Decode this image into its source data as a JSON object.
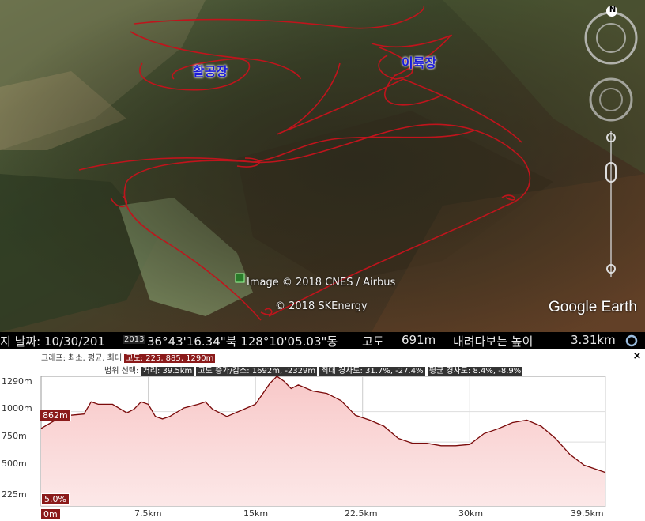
{
  "map": {
    "north_label": "N",
    "places": [
      "활공장",
      "이륙장"
    ],
    "attribution_1": "Image © 2018 CNES / Airbus",
    "attribution_2": "© 2018 SKEnergy",
    "logo": "Google Earth",
    "track_color": "#c0141c"
  },
  "status": {
    "date_label": "지 날짜: 10/30/201",
    "year_badge": "2013",
    "coords": "36°43'16.34\"북 128°10'05.03\"동",
    "alt_label": "고도",
    "alt_value": "691m",
    "eye_label": "내려다보는 높이",
    "eye_value": "3.31km"
  },
  "profile": {
    "graph_label": "그래프: 최소, 평균, 최대",
    "elev_label": "고도:",
    "elev_values": "225, 885, 1290m",
    "range_label": "범위 선택:",
    "distance": "거리: 39.5km",
    "gain_loss": "고도 증가/감소: 1692m, -2329m",
    "max_slope": "최대 경사도: 31.7%, -27.4%",
    "avg_slope": "평균 경사도: 8.4%, -8.9%",
    "close": "×",
    "yticks": [
      "1290m",
      "1000m",
      "750m",
      "500m",
      "225m"
    ],
    "xticks": [
      "0m",
      "7.5km",
      "15km",
      "22.5km",
      "30km",
      "39.5km"
    ],
    "start_badge": "862m",
    "slope_badge": "5.0%"
  },
  "chart_data": {
    "type": "area",
    "xlabel": "",
    "ylabel": "",
    "xlim": [
      0,
      39.5
    ],
    "ylim": [
      225,
      1290
    ],
    "x": [
      0,
      1,
      2,
      3,
      3.5,
      4,
      5,
      6,
      6.5,
      7,
      7.5,
      8,
      8.5,
      9,
      10,
      11,
      11.5,
      12,
      13,
      14,
      15,
      16,
      16.5,
      17,
      17.5,
      18,
      19,
      20,
      21,
      22,
      23,
      24,
      25,
      26,
      27,
      28,
      29,
      30,
      31,
      32,
      33,
      34,
      35,
      36,
      37,
      38,
      39,
      39.5
    ],
    "values": [
      862,
      930,
      970,
      980,
      1080,
      1060,
      1060,
      990,
      1020,
      1080,
      1060,
      960,
      940,
      960,
      1030,
      1060,
      1080,
      1020,
      960,
      1010,
      1060,
      1230,
      1290,
      1250,
      1190,
      1220,
      1170,
      1150,
      1090,
      970,
      930,
      880,
      780,
      740,
      740,
      720,
      720,
      730,
      820,
      860,
      910,
      930,
      880,
      780,
      650,
      560,
      520,
      500
    ]
  }
}
